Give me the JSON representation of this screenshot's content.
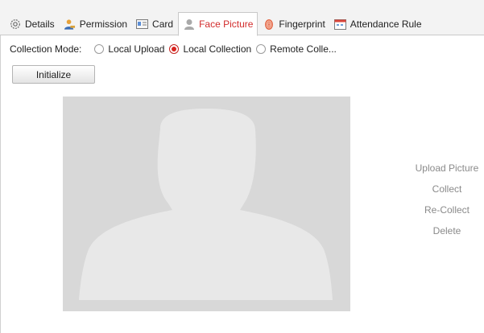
{
  "tabs": [
    {
      "label": "Details",
      "icon": "gear-icon"
    },
    {
      "label": "Permission",
      "icon": "user-key-icon"
    },
    {
      "label": "Card",
      "icon": "id-card-icon"
    },
    {
      "label": "Face Picture",
      "icon": "person-icon",
      "active": true
    },
    {
      "label": "Fingerprint",
      "icon": "fingerprint-icon"
    },
    {
      "label": "Attendance Rule",
      "icon": "calendar-icon"
    }
  ],
  "collection_mode": {
    "label": "Collection Mode:",
    "options": [
      {
        "label": "Local Upload",
        "checked": false
      },
      {
        "label": "Local Collection",
        "checked": true
      },
      {
        "label": "Remote Colle...",
        "checked": false
      }
    ]
  },
  "initialize_label": "Initialize",
  "actions": {
    "upload": "Upload Picture",
    "collect": "Collect",
    "recollect": "Re-Collect",
    "delete": "Delete"
  },
  "colors": {
    "accent": "#d22b2b",
    "placeholder_bg": "#d8d8d8",
    "silhouette": "#e8e8e8",
    "action_text": "#8a8a8a"
  }
}
